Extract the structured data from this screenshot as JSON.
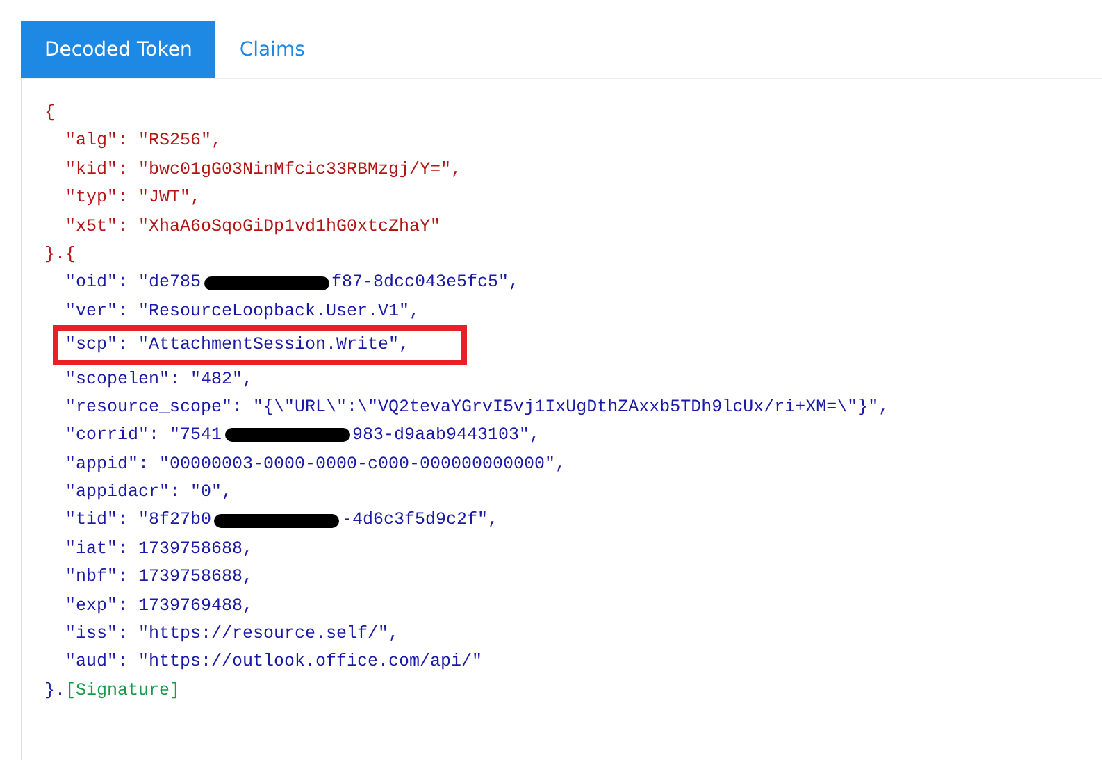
{
  "tabs": [
    {
      "label": "Decoded Token",
      "selected": true
    },
    {
      "label": "Claims",
      "selected": false
    }
  ],
  "header": {
    "open": "{",
    "fields": [
      {
        "key": "\"alg\":",
        "value": "\"RS256\","
      },
      {
        "key": "\"kid\":",
        "value": "\"bwc01gG03NinMfcic33RBMzgj/Y=\","
      },
      {
        "key": "\"typ\":",
        "value": "\"JWT\","
      },
      {
        "key": "\"x5t\":",
        "value": "\"XhaA6oSqoGiDp1vd1hG0xtcZhaY\""
      }
    ],
    "close": "}.{"
  },
  "payload": {
    "fields": [
      {
        "key": "\"oid\":",
        "value": "\"de785",
        "redacted": true,
        "rest": "f87-8dcc043e5fc5\","
      },
      {
        "key": "\"ver\":",
        "value": "\"ResourceLoopback.User.V1\","
      },
      {
        "key": "\"scp\":",
        "value": "\"AttachmentSession.Write\",",
        "highlighted": true
      },
      {
        "key": "\"scopelen\":",
        "value": "\"482\","
      },
      {
        "key": "\"resource_scope\":",
        "value": "\"{\\\"URL\\\":\\\"VQ2tevaYGrvI5vj1IxUgDthZAxxb5TDh9lcUx/ri+XM=\\\"}\","
      },
      {
        "key": "\"corrid\":",
        "value": "\"7541",
        "redacted": true,
        "rest": "983-d9aab9443103\","
      },
      {
        "key": "\"appid\":",
        "value": "\"00000003-0000-0000-c000-000000000000\","
      },
      {
        "key": "\"appidacr\":",
        "value": "\"0\","
      },
      {
        "key": "\"tid\":",
        "value": "\"8f27b0",
        "redacted": true,
        "rest": "-4d6c3f5d9c2f\","
      },
      {
        "key": "\"iat\":",
        "value": "1739758688,"
      },
      {
        "key": "\"nbf\":",
        "value": "1739758688,"
      },
      {
        "key": "\"exp\":",
        "value": "1739769488,"
      },
      {
        "key": "\"iss\":",
        "value": "\"https://resource.self/\","
      },
      {
        "key": "\"aud\":",
        "value": "\"https://outlook.office.com/api/\""
      }
    ],
    "close": "}.",
    "signature": "[Signature]"
  }
}
